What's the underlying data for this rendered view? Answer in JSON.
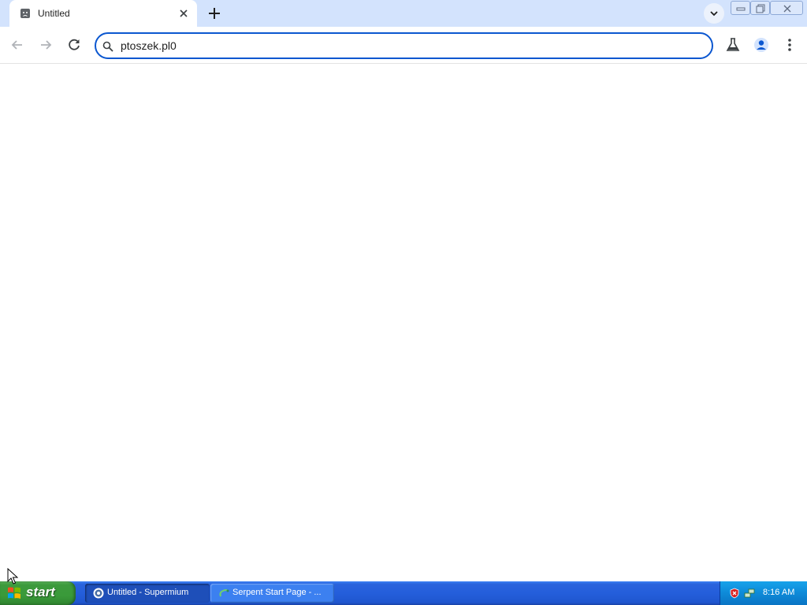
{
  "browser": {
    "tab": {
      "title": "Untitled",
      "favicon": "sad-tab-icon",
      "close_icon": "close-icon"
    },
    "new_tab_icon": "plus-icon",
    "tab_search_icon": "chevron-down-icon",
    "window_controls": [
      "minimize-icon",
      "restore-icon",
      "close-icon"
    ]
  },
  "toolbar": {
    "back_icon": "arrow-left-icon",
    "forward_icon": "arrow-right-icon",
    "reload_icon": "reload-icon",
    "omnibox": {
      "value": "ptoszek.pl0",
      "icon": "search-icon"
    },
    "labs_icon": "flask-icon",
    "profile_icon": "account-icon",
    "menu_icon": "kebab-menu-icon"
  },
  "taskbar": {
    "start_label": "start",
    "tasks": [
      {
        "label": "Untitled - Supermium",
        "icon": "supermium-icon",
        "active": true
      },
      {
        "label": "Serpent Start Page - ...",
        "icon": "serpent-icon",
        "active": false
      }
    ],
    "tray": {
      "icons": [
        "shield-alert-icon",
        "network-icon"
      ],
      "clock": "8:16 AM"
    }
  },
  "colors": {
    "tabstrip_bg": "#d3e3fd",
    "omnibox_focus": "#0b57d0",
    "taskbar_blue": "#245edb",
    "start_green": "#3a9a3a",
    "tray_blue": "#0e8ad8"
  }
}
